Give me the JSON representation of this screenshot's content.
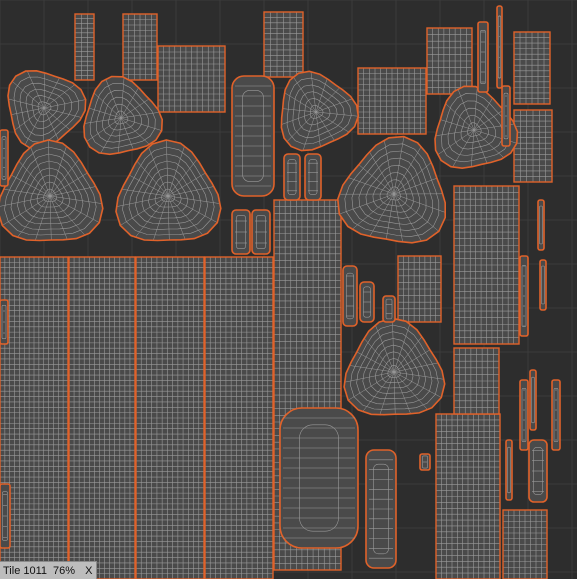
{
  "viewport": {
    "background_color": "#2d2d2d",
    "grid_color": "#3c3c3c",
    "island_outline_color": "#e0622a",
    "mesh_line_color": "#9a9a9a",
    "island_fill_color": "#4a4a4a"
  },
  "status": {
    "tile_label": "Tile 1011",
    "zoom": "76%",
    "close_label": "X"
  }
}
